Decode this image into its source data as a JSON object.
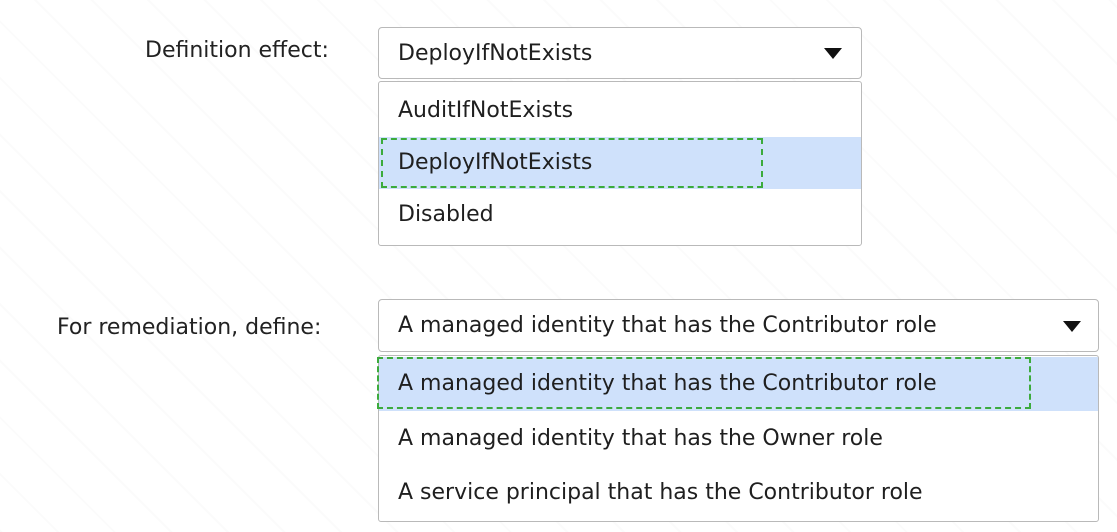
{
  "definition": {
    "label": "Definition effect:",
    "selected_value": "DeployIfNotExists",
    "options": [
      "AuditIfNotExists",
      "DeployIfNotExists",
      "Disabled"
    ],
    "highlighted_option": "DeployIfNotExists"
  },
  "remediation": {
    "label": "For remediation, define:",
    "selected_value": "A managed identity that has the Contributor role",
    "options": [
      "A managed identity that has the Contributor role",
      "A managed identity that has the Owner role",
      "A service principal that has the Contributor role"
    ],
    "highlighted_option": "A managed identity that has the Contributor role"
  },
  "colors": {
    "highlight": "#cfe1fb",
    "answer_outline": "#3cab3c"
  },
  "icons": {
    "dropdown": "caret-down-icon"
  }
}
